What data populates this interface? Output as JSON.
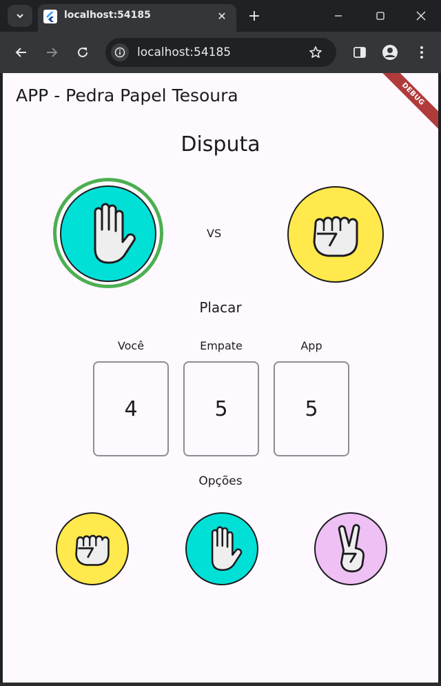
{
  "browser": {
    "tab_title": "localhost:54185",
    "url": "localhost:54185"
  },
  "app": {
    "title": "APP - Pedra Papel Tesoura",
    "debug_label": "DEBUG",
    "battle": {
      "title": "Disputa",
      "vs_label": "VS",
      "player_choice": "paper-hand-icon",
      "app_choice": "rock-fist-icon"
    },
    "score": {
      "title": "Placar",
      "columns": [
        {
          "label": "Você",
          "value": "4"
        },
        {
          "label": "Empate",
          "value": "5"
        },
        {
          "label": "App",
          "value": "5"
        }
      ]
    },
    "options": {
      "title": "Opções",
      "items": [
        "rock-fist-icon",
        "paper-hand-icon",
        "scissors-hand-icon"
      ]
    }
  },
  "colors": {
    "winner_ring": "#4caf50",
    "rock": "#ffe94c",
    "paper": "#00e0d6",
    "scissors": "#eec0f4",
    "background": "#fdf9ff",
    "debug_banner": "#b13b3b"
  }
}
